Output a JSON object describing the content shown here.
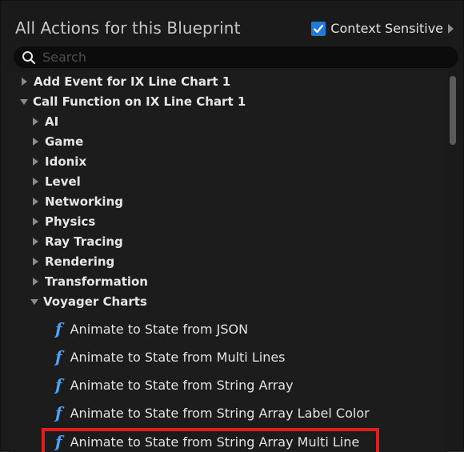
{
  "header": {
    "title": "All Actions for this Blueprint",
    "context_label": "Context Sensitive",
    "context_checked": true
  },
  "search": {
    "placeholder": "Search"
  },
  "tree": {
    "top_items": [
      {
        "label": "Add Event for IX Line Chart 1",
        "expanded": false
      },
      {
        "label": "Call Function on IX Line Chart 1",
        "expanded": true
      }
    ],
    "categories": [
      {
        "label": "AI",
        "expanded": false
      },
      {
        "label": "Game",
        "expanded": false
      },
      {
        "label": "Idonix",
        "expanded": false
      },
      {
        "label": "Level",
        "expanded": false
      },
      {
        "label": "Networking",
        "expanded": false
      },
      {
        "label": "Physics",
        "expanded": false
      },
      {
        "label": "Ray Tracing",
        "expanded": false
      },
      {
        "label": "Rendering",
        "expanded": false
      },
      {
        "label": "Transformation",
        "expanded": false
      },
      {
        "label": "Voyager Charts",
        "expanded": true
      }
    ],
    "functions": [
      {
        "label": "Animate to State from JSON",
        "icon": "function-icon"
      },
      {
        "label": "Animate to State from Multi Lines",
        "icon": "function-icon"
      },
      {
        "label": "Animate to State from String Array",
        "icon": "function-icon"
      },
      {
        "label": "Animate to State from String Array Label Color",
        "icon": "function-icon"
      },
      {
        "label": "Animate to State from String Array Multi Line",
        "icon": "function-icon",
        "highlighted": true
      }
    ]
  },
  "colors": {
    "accent": "#1f7ad6",
    "highlight": "#e21d1d",
    "function_icon": "#4aa3ff"
  }
}
